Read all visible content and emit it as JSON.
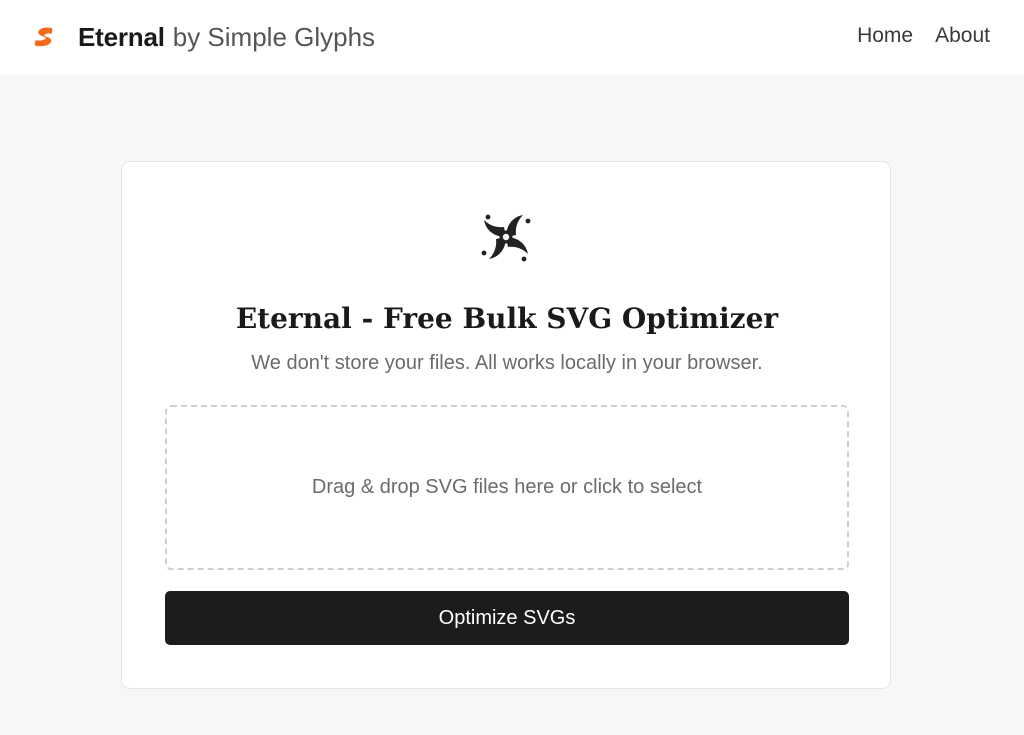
{
  "header": {
    "brand_name": "Eternal",
    "brand_suffix": "by Simple Glyphs",
    "brand_color": "#f26b1d",
    "logo_icon": "orange-s-glyph-icon",
    "nav": [
      {
        "label": "Home"
      },
      {
        "label": "About"
      }
    ]
  },
  "main": {
    "hero_icon": "swirl-vortex-icon",
    "title": "Eternal - Free Bulk SVG Optimizer",
    "subtitle": "We don't store your files. All works locally in your browser.",
    "dropzone_text": "Drag & drop SVG files here or click to select",
    "optimize_label": "Optimize SVGs",
    "button_color": "#1c1c1c"
  }
}
